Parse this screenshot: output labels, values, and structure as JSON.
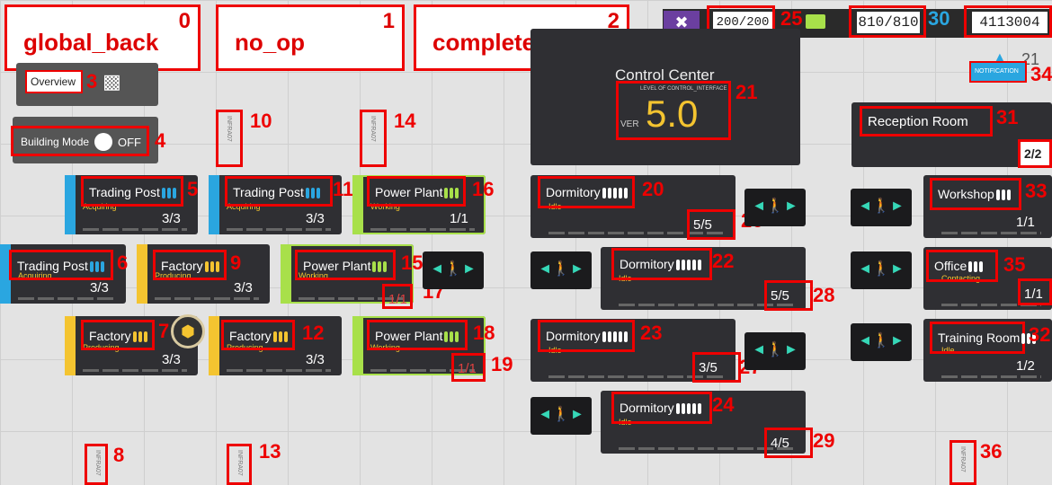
{
  "labels": [
    {
      "id": "0",
      "text": "global_back"
    },
    {
      "id": "1",
      "text": "no_op"
    },
    {
      "id": "2",
      "text": "complete"
    }
  ],
  "overview": {
    "label": "Overview",
    "num": "3"
  },
  "building_mode": {
    "label": "Building Mode",
    "state": "OFF",
    "num": "4"
  },
  "resources": {
    "drones": "200/200",
    "drones_num": "25",
    "lmd": "810/810",
    "lmd_num": "30",
    "orundum": "4113004"
  },
  "notification": {
    "label": "NOTIFICATION",
    "num": "34",
    "count": "21"
  },
  "control_center": {
    "title": "Control Center",
    "level_label": "LEVEL OF CONTROL_INTERFACE",
    "ver": "VER",
    "level": "5.0",
    "num": "21"
  },
  "reception": {
    "name": "Reception Room",
    "num": "31",
    "count": "2/2"
  },
  "markers": [
    {
      "num": "10",
      "text": "INFRA07"
    },
    {
      "num": "14",
      "text": "INFRA07"
    },
    {
      "num": "8",
      "text": "INFRA07"
    },
    {
      "num": "13",
      "text": "INFRA07"
    },
    {
      "num": "36",
      "text": "INFRA07"
    }
  ],
  "rooms": [
    {
      "num": "5",
      "name": "Trading Post",
      "sub": "Acquiring",
      "cnt": "3/3"
    },
    {
      "num": "11",
      "name": "Trading Post",
      "sub": "Acquiring",
      "cnt": "3/3"
    },
    {
      "num": "16",
      "name": "Power Plant",
      "sub": "Working",
      "cnt": "1/1"
    },
    {
      "num": "6",
      "name": "Trading Post",
      "sub": "Acquiring",
      "cnt": "3/3"
    },
    {
      "num": "9",
      "name": "Factory",
      "sub": "Producing",
      "cnt": "3/3"
    },
    {
      "num": "15",
      "name": "Power Plant",
      "sub": "Working",
      "cnt": "1/1",
      "cnt_num": "17"
    },
    {
      "num": "7",
      "name": "Factory",
      "sub": "Producing",
      "cnt": "3/3"
    },
    {
      "num": "12",
      "name": "Factory",
      "sub": "Producing",
      "cnt": "3/3"
    },
    {
      "num": "18",
      "name": "Power Plant",
      "sub": "Working",
      "cnt": "1/1",
      "cnt_num": "19"
    },
    {
      "num": "20",
      "name": "Dormitory",
      "sub": "Idle",
      "cnt": "5/5",
      "cnt_num": "26"
    },
    {
      "num": "22",
      "name": "Dormitory",
      "sub": "Idle",
      "cnt": "5/5",
      "cnt_num": "28"
    },
    {
      "num": "23",
      "name": "Dormitory",
      "sub": "Idle",
      "cnt": "3/5",
      "cnt_num": "27"
    },
    {
      "num": "24",
      "name": "Dormitory",
      "sub": "Idle",
      "cnt": "4/5",
      "cnt_num": "29"
    },
    {
      "num": "33",
      "name": "Workshop",
      "sub": "",
      "cnt": "1/1"
    },
    {
      "num": "35",
      "name": "Office",
      "sub": "Contacting",
      "cnt": "1/1"
    },
    {
      "num": "32",
      "name": "Training Room",
      "sub": "Idle",
      "cnt": "1/2"
    }
  ],
  "colors": {
    "trading": "#2aa6e0",
    "factory": "#f4c430",
    "power": "#a8e04a",
    "dorm": "#ffffff",
    "red": "#e00000"
  }
}
